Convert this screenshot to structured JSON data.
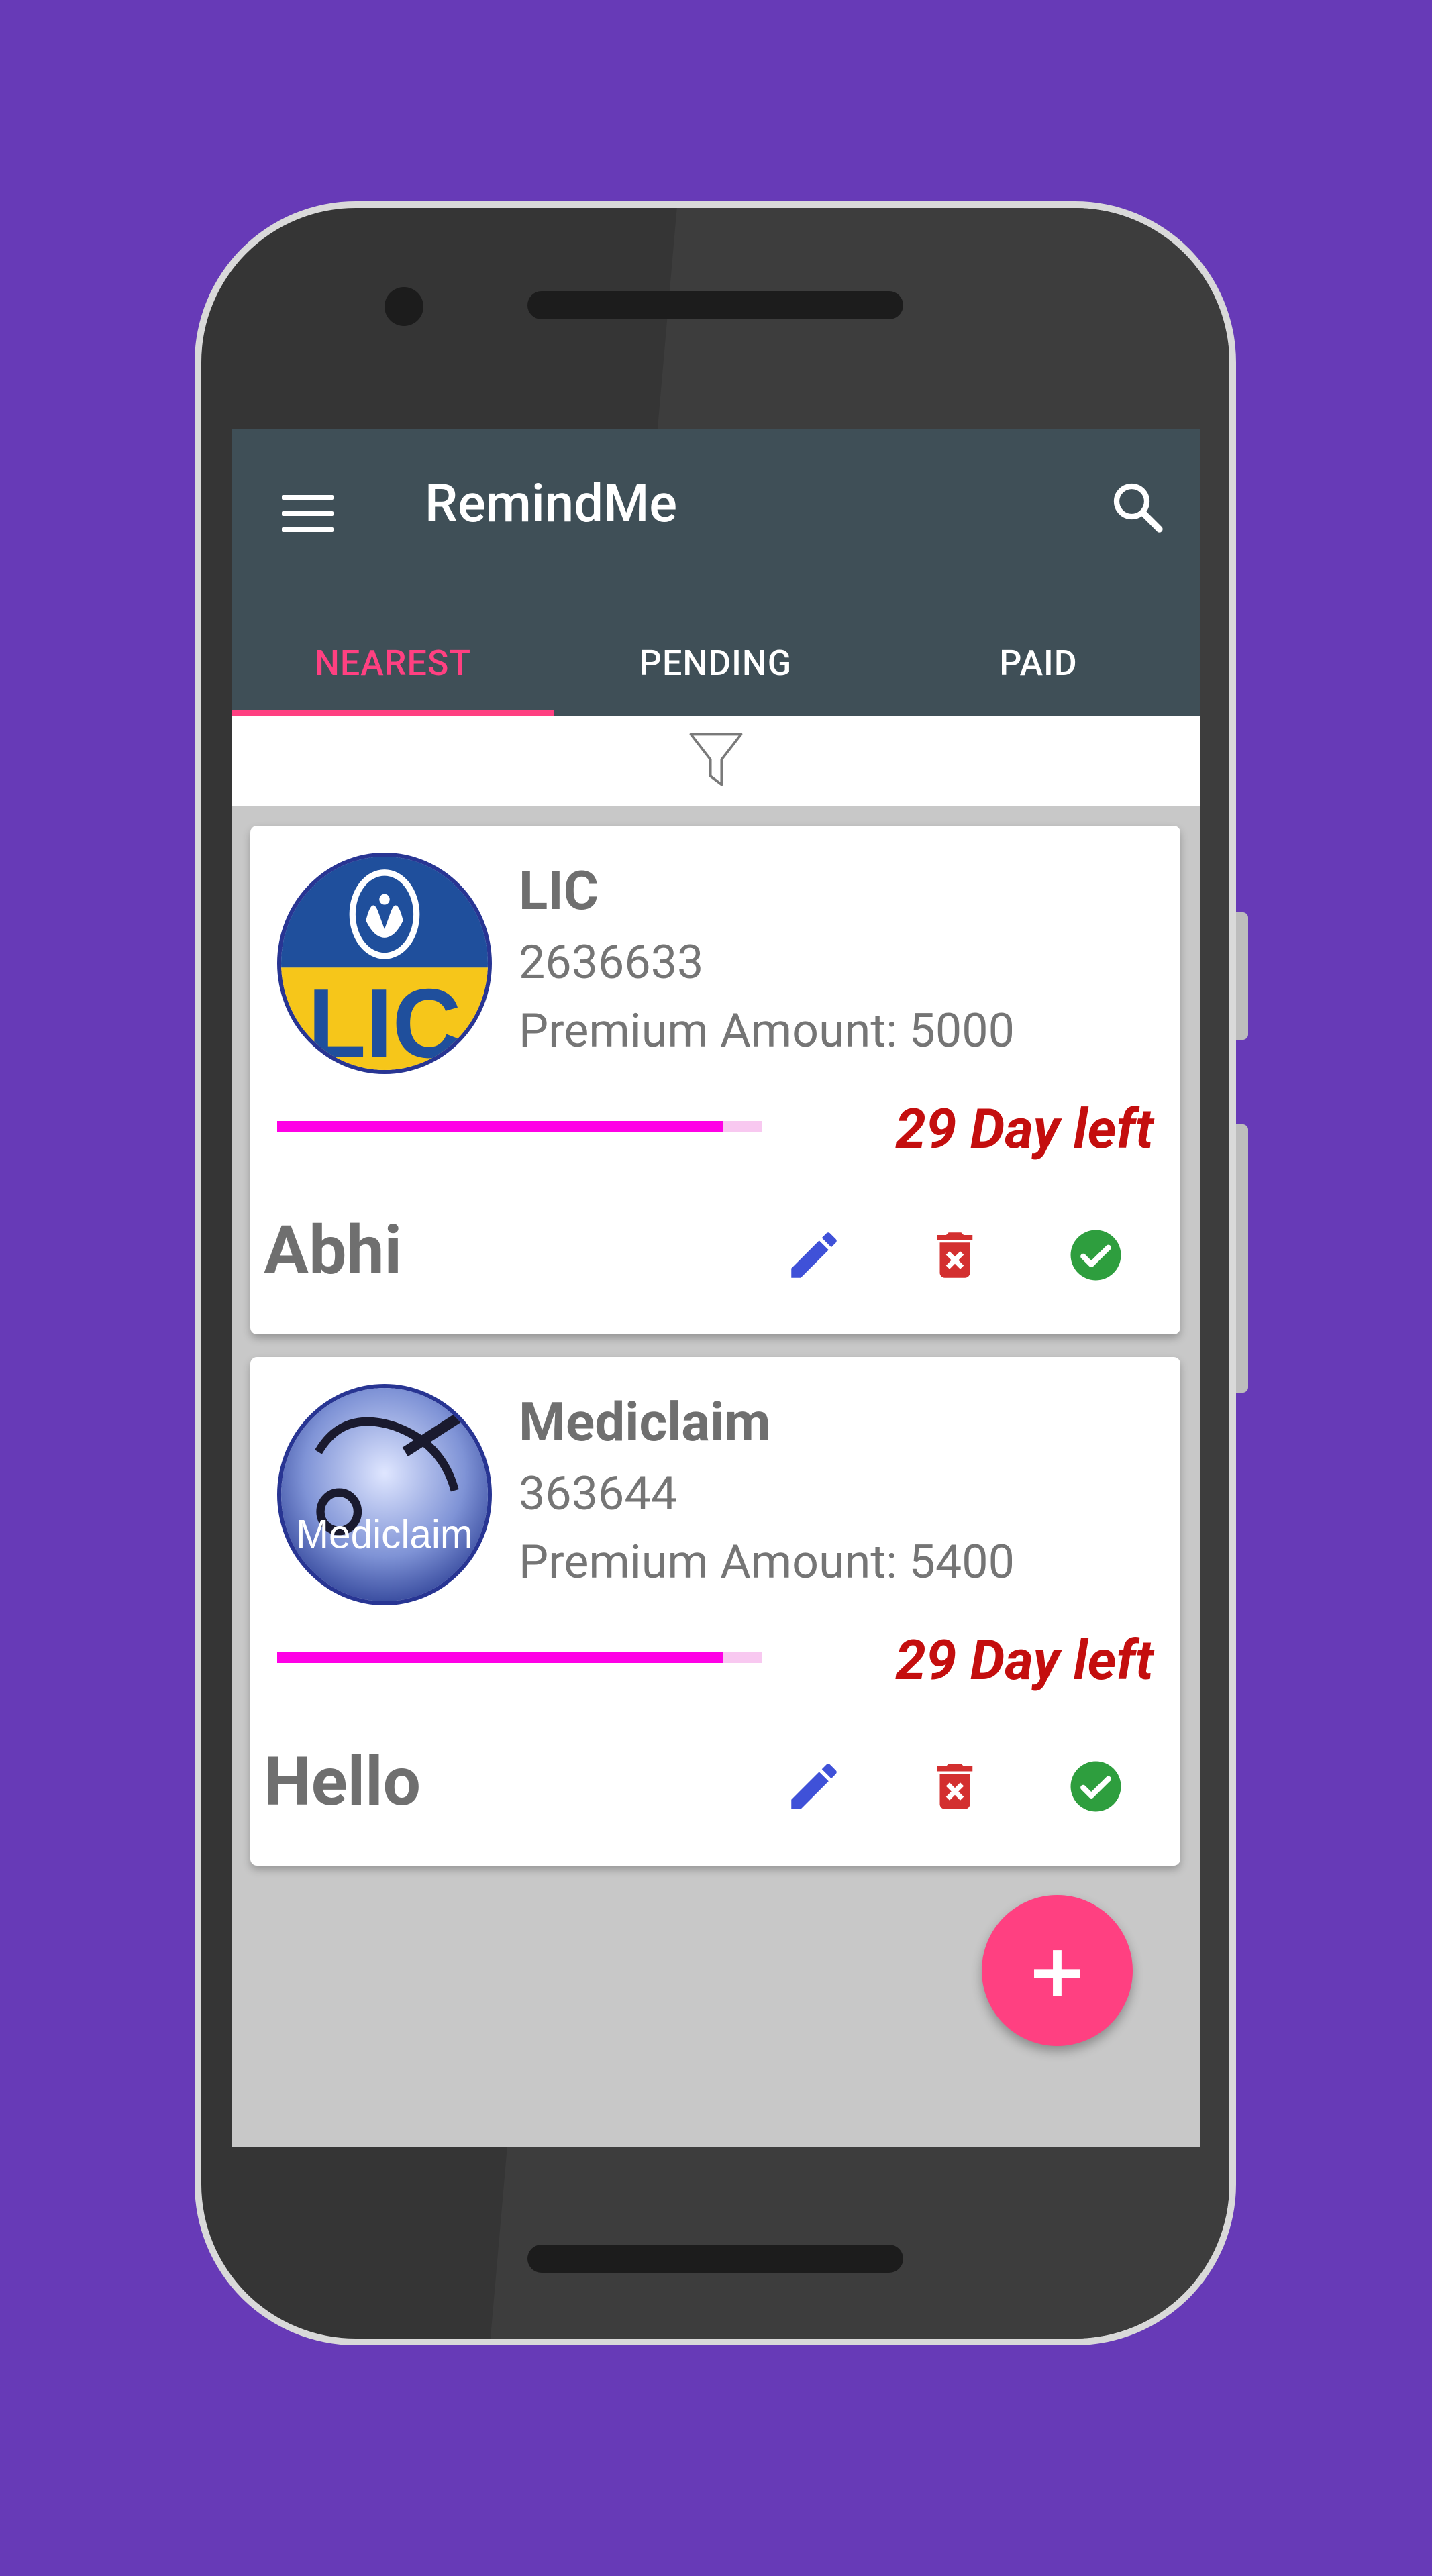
{
  "app": {
    "title": "RemindMe"
  },
  "tabs": [
    {
      "label": "NEAREST",
      "active": true
    },
    {
      "label": "PENDING",
      "active": false
    },
    {
      "label": "PAID",
      "active": false
    }
  ],
  "icons": {
    "menu": "menu-icon",
    "search": "search-icon",
    "filter": "filter-icon",
    "edit": "edit-icon",
    "delete": "delete-icon",
    "mark_paid": "check-circle-icon",
    "add": "add-icon"
  },
  "cards": [
    {
      "policy": "LIC",
      "number": "2636633",
      "premium_label": "Premium Amount: ",
      "premium_amount": "5000",
      "days_left": "29 Day left",
      "holder": "Abhi",
      "progress": 0.92,
      "logo_text": "LIC"
    },
    {
      "policy": "Mediclaim",
      "number": "363644",
      "premium_label": "Premium Amount: ",
      "premium_amount": "5400",
      "days_left": "29 Day left",
      "holder": "Hello",
      "progress": 0.92,
      "logo_text": "Mediclaim"
    }
  ],
  "fab": {
    "label": "+"
  },
  "colors": {
    "background": "#673ab7",
    "appbar": "#3f4f57",
    "accent": "#ff4081",
    "progress_fill": "#ff00e6",
    "progress_track": "#f8c8f0",
    "days_left": "#c40e0e",
    "edit": "#3f51d8",
    "delete": "#d32f2f",
    "paid": "#2e9e3e"
  }
}
